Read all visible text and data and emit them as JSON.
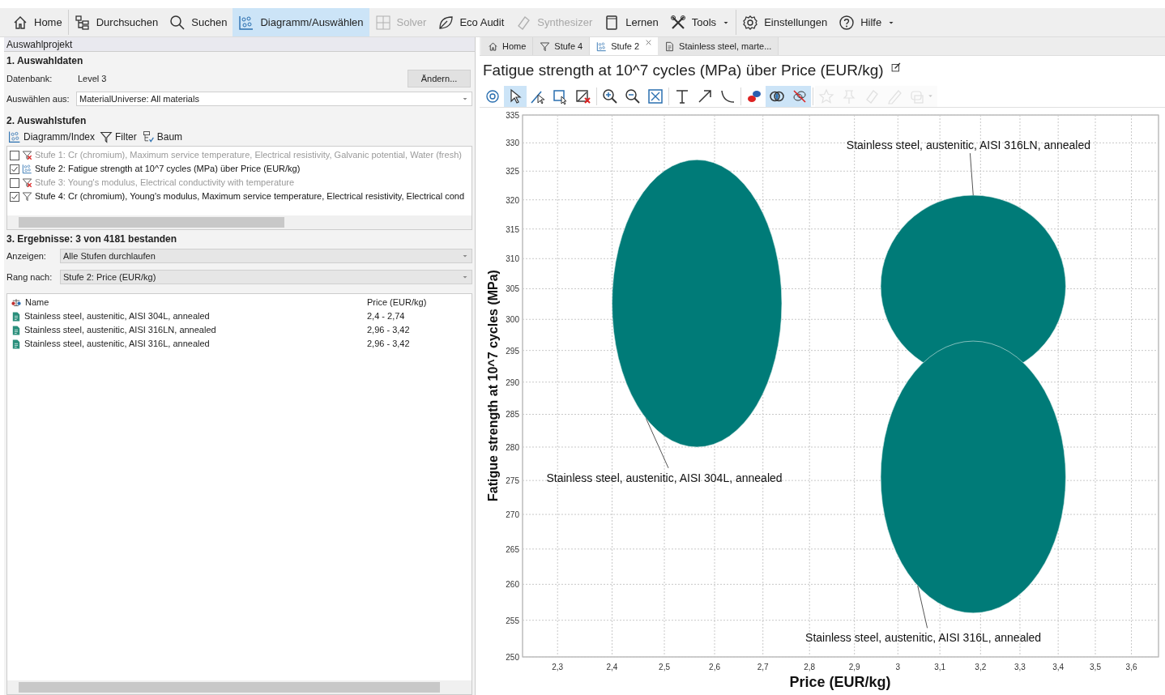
{
  "toolbar": [
    {
      "label": "Home",
      "selected": false,
      "disabled": false,
      "dropdown": false
    },
    {
      "label": "Durchsuchen",
      "selected": false,
      "disabled": false,
      "dropdown": false
    },
    {
      "label": "Suchen",
      "selected": false,
      "disabled": false,
      "dropdown": false
    },
    {
      "label": "Diagramm/Auswählen",
      "selected": true,
      "disabled": false,
      "dropdown": false
    },
    {
      "label": "Solver",
      "selected": false,
      "disabled": true,
      "dropdown": false
    },
    {
      "label": "Eco Audit",
      "selected": false,
      "disabled": false,
      "dropdown": false
    },
    {
      "label": "Synthesizer",
      "selected": false,
      "disabled": true,
      "dropdown": false
    },
    {
      "label": "Lernen",
      "selected": false,
      "disabled": false,
      "dropdown": false
    },
    {
      "label": "Tools",
      "selected": false,
      "disabled": false,
      "dropdown": true
    },
    {
      "label": "Einstellungen",
      "selected": false,
      "disabled": false,
      "dropdown": false
    },
    {
      "label": "Hilfe",
      "selected": false,
      "disabled": false,
      "dropdown": true
    }
  ],
  "left_panel": {
    "title": "Auswahlprojekt",
    "section_1": {
      "heading": "1. Auswahldaten",
      "database_label": "Datenbank:",
      "database_value": "Level 3",
      "change_button": "Ändern...",
      "source_label": "Auswählen aus:",
      "source_value": "MaterialUniverse: All materials"
    },
    "section_2": {
      "heading": "2. Auswahlstufen",
      "buttons": [
        "Diagramm/Index",
        "Filter",
        "Baum"
      ],
      "stages": [
        {
          "label": "Stufe 1: Cr (chromium), Maximum service temperature, Electrical resistivity, Galvanic potential, Water (fresh)",
          "kind": "filter",
          "checked": false
        },
        {
          "label": "Stufe 2: Fatigue strength at 10^7 cycles (MPa) über Price (EUR/kg)",
          "kind": "chart",
          "checked": true
        },
        {
          "label": "Stufe 3: Young's modulus, Electrical conductivity with temperature",
          "kind": "filter",
          "checked": false
        },
        {
          "label": "Stufe 4: Cr (chromium), Young's modulus, Maximum service temperature, Electrical resistivity, Electrical cond",
          "kind": "filter",
          "checked": true
        }
      ]
    },
    "section_3": {
      "heading": "3. Ergebnisse: 3 von 4181 bestanden",
      "show_label": "Anzeigen:",
      "show_value": "Alle Stufen durchlaufen",
      "rank_label": "Rang nach:",
      "rank_value": "Stufe 2: Price (EUR/kg)",
      "columns": [
        "Name",
        "Price (EUR/kg)"
      ],
      "rows": [
        [
          "Stainless steel, austenitic, AISI 304L, annealed",
          "2,4 - 2,74"
        ],
        [
          "Stainless steel, austenitic, AISI 316LN, annealed",
          "2,96 - 3,42"
        ],
        [
          "Stainless steel, austenitic, AISI 316L, annealed",
          "2,96 - 3,42"
        ]
      ]
    }
  },
  "right_panel": {
    "tabs": [
      {
        "label": "Home",
        "selected": false,
        "closable": false
      },
      {
        "label": "Stufe 4",
        "selected": false,
        "closable": false
      },
      {
        "label": "Stufe 2",
        "selected": true,
        "closable": true
      },
      {
        "label": "Stainless steel, marte...",
        "selected": false,
        "closable": false
      }
    ],
    "title": "Fatigue strength at 10^7 cycles (MPa) über Price (EUR/kg)",
    "chart_tools": [
      {
        "kind": "settings",
        "selected": false,
        "disabled": false
      },
      {
        "kind": "pointer",
        "selected": true,
        "disabled": false
      },
      {
        "kind": "line-select",
        "selected": false,
        "disabled": false
      },
      {
        "kind": "box-select",
        "selected": false,
        "disabled": false
      },
      {
        "kind": "delete",
        "selected": false,
        "disabled": false
      },
      {
        "kind": "zoom-in",
        "selected": false,
        "disabled": false
      },
      {
        "kind": "zoom-out",
        "selected": false,
        "disabled": false
      },
      {
        "kind": "fit",
        "selected": false,
        "disabled": false
      },
      {
        "kind": "text",
        "selected": false,
        "disabled": false
      },
      {
        "kind": "arrow",
        "selected": false,
        "disabled": false
      },
      {
        "kind": "curve",
        "selected": false,
        "disabled": false
      },
      {
        "kind": "bubbles",
        "selected": false,
        "disabled": false
      },
      {
        "kind": "overlap",
        "selected": true,
        "disabled": false
      },
      {
        "kind": "hide",
        "selected": true,
        "disabled": false
      },
      {
        "kind": "star",
        "selected": false,
        "disabled": true
      },
      {
        "kind": "pin",
        "selected": false,
        "disabled": true
      },
      {
        "kind": "eraser",
        "selected": false,
        "disabled": true
      },
      {
        "kind": "pencil",
        "selected": false,
        "disabled": true
      },
      {
        "kind": "layers",
        "selected": false,
        "disabled": true
      }
    ],
    "chart": {
      "xlabel": "Price (EUR/kg)",
      "ylabel": "Fatigue strength at 10^7 cycles (MPa)",
      "x_tick_labels": [
        "2,3",
        "2,4",
        "2,5",
        "2,6",
        "2,7",
        "2,8",
        "2,9",
        "3",
        "3,1",
        "3,2",
        "3,3",
        "3,4",
        "3,5",
        "3,6"
      ],
      "y_tick_labels": [
        "335",
        "330",
        "325",
        "320",
        "315",
        "310",
        "305",
        "300",
        "295",
        "290",
        "285",
        "280",
        "275",
        "270",
        "265",
        "260",
        "255",
        "250"
      ],
      "bubble_labels": [
        "Stainless steel, austenitic, AISI 304L, annealed",
        "Stainless steel, austenitic, AISI 316LN, annealed",
        "Stainless steel, austenitic, AISI 316L, annealed"
      ]
    }
  }
}
